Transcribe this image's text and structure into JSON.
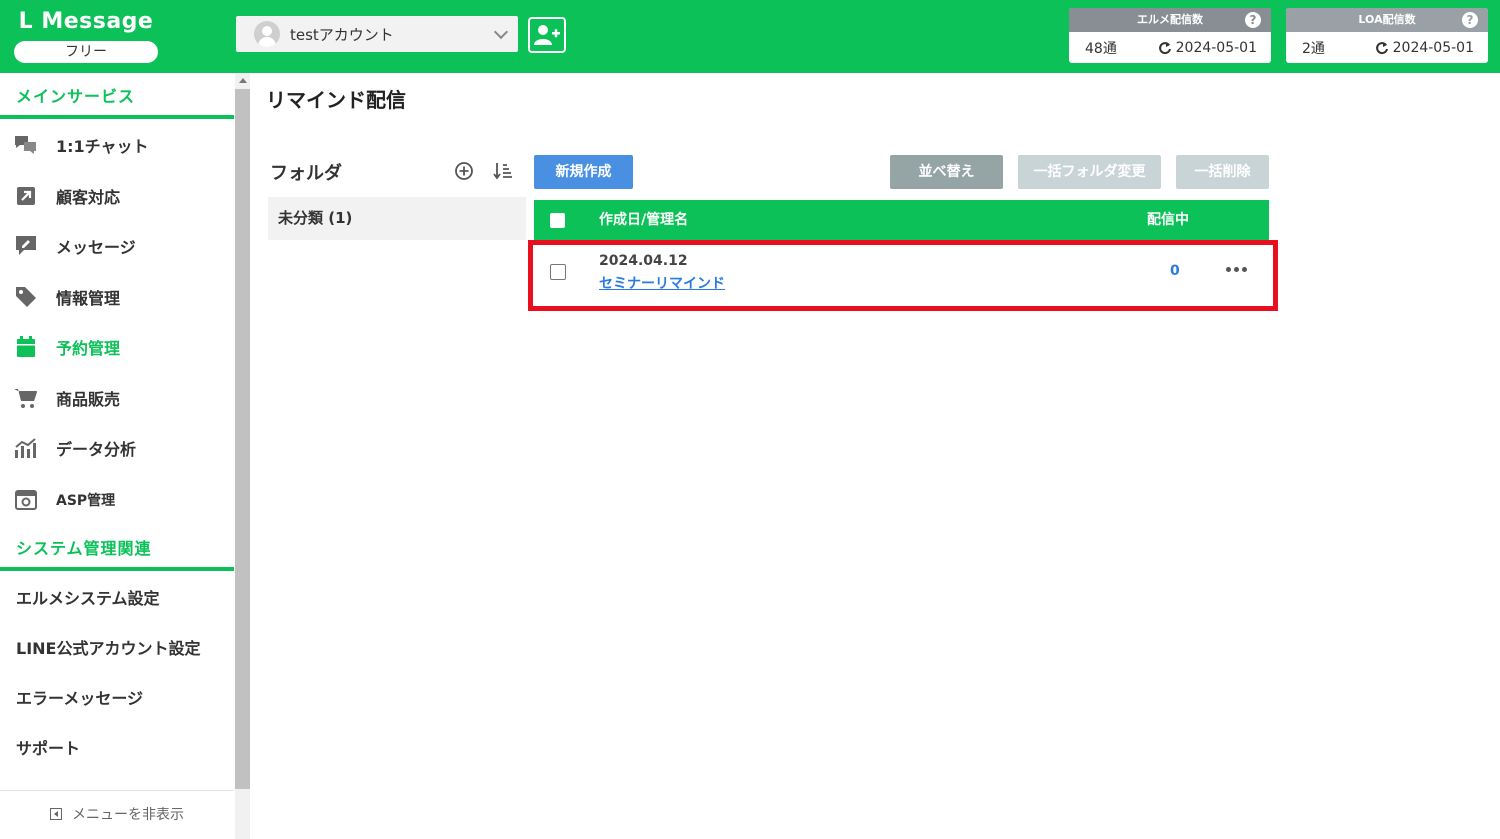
{
  "brand": {
    "name": "L Message",
    "plan": "フリー"
  },
  "account": {
    "name": "testアカウント"
  },
  "stats": [
    {
      "label": "エルメ配信数",
      "count": "48通",
      "reset_date": "2024-05-01",
      "help": "?"
    },
    {
      "label": "LOA配信数",
      "count": "2通",
      "reset_date": "2024-05-01",
      "help": "?"
    }
  ],
  "sidebar": {
    "main_section": "メインサービス",
    "items": [
      {
        "label": "1:1チャット",
        "icon": "chat-icon"
      },
      {
        "label": "顧客対応",
        "icon": "external-link-icon"
      },
      {
        "label": "メッセージ",
        "icon": "message-edit-icon"
      },
      {
        "label": "情報管理",
        "icon": "tag-icon"
      },
      {
        "label": "予約管理",
        "icon": "calendar-icon",
        "active": true
      },
      {
        "label": "商品販売",
        "icon": "cart-icon"
      },
      {
        "label": "データ分析",
        "icon": "chart-icon"
      },
      {
        "label": "ASP管理",
        "icon": "asp-icon"
      }
    ],
    "system_section": "システム管理関連",
    "system_items": [
      {
        "label": "エルメシステム設定"
      },
      {
        "label": "LINE公式アカウント設定"
      },
      {
        "label": "エラーメッセージ"
      },
      {
        "label": "サポート"
      }
    ],
    "hide_menu": "メニューを非表示"
  },
  "main": {
    "title": "リマインド配信",
    "folder_label": "フォルダ",
    "folders": [
      {
        "label": "未分類 (1)"
      }
    ],
    "buttons": {
      "new": "新規作成",
      "sort": "並べ替え",
      "bulk_folder": "一括フォルダ変更",
      "bulk_delete": "一括削除"
    },
    "table": {
      "col_name": "作成日/管理名",
      "col_sending": "配信中",
      "rows": [
        {
          "date": "2024.04.12",
          "name": "セミナーリマインド",
          "sending": "0"
        }
      ]
    }
  },
  "colors": {
    "brand_green": "#0bc158",
    "primary_blue": "#4a90e2",
    "highlight_red": "#e8101e"
  }
}
